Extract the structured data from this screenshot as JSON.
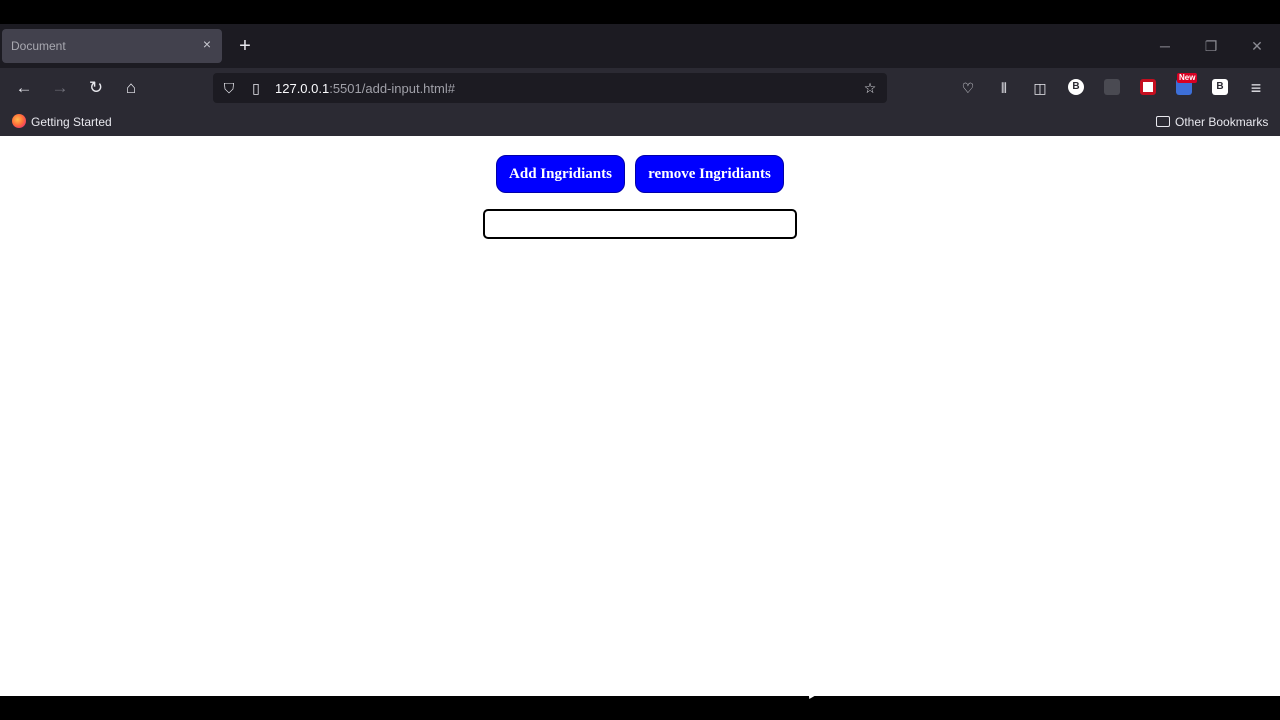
{
  "browser": {
    "tab": {
      "title": "Document",
      "close_glyph": "×"
    },
    "new_tab_glyph": "+",
    "window_controls": {
      "minimize": "─",
      "restore": "❐",
      "close": "✕"
    },
    "nav": {
      "back": "←",
      "forward": "→",
      "reload": "↻",
      "home": "⌂"
    },
    "url": {
      "host": "127.0.0.1",
      "rest": ":5501/add-input.html#"
    },
    "url_icons": {
      "shield": "⛉",
      "page": "▯",
      "star": "☆"
    },
    "toolbar": {
      "pocket": "♡",
      "library": "⫴",
      "sidebar": "◫",
      "ext_b_label": "B",
      "ext_new_badge": "New",
      "ext_b2_label": "B",
      "menu": "≡"
    },
    "bookmarks": {
      "getting_started": "Getting Started",
      "other": "Other Bookmarks"
    }
  },
  "page": {
    "add_button_label": "Add Ingridiants",
    "remove_button_label": "remove Ingridiants",
    "ingredient_input_value": ""
  },
  "colors": {
    "button_bg": "#0000ff",
    "chrome_dark": "#1c1b22",
    "chrome": "#2b2a33"
  }
}
